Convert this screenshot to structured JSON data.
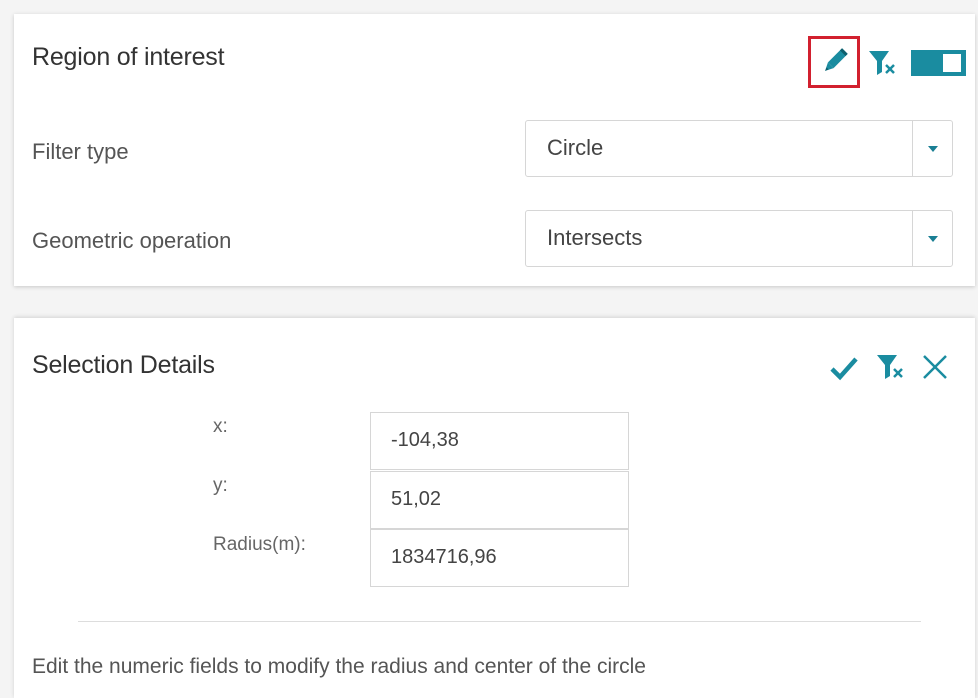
{
  "roi": {
    "title": "Region of interest",
    "filter_type": {
      "label": "Filter type",
      "value": "Circle"
    },
    "geometric_operation": {
      "label": "Geometric operation",
      "value": "Intersects"
    },
    "icons": [
      "edit-pencil-icon",
      "clear-filter-icon",
      "toggle-switch"
    ],
    "highlight_color": "#d2202f",
    "accent_color": "#1a8ca0"
  },
  "selection": {
    "title": "Selection Details",
    "icons": [
      "check-icon",
      "clear-filter-icon",
      "close-icon"
    ],
    "x": {
      "label": "x:",
      "value": "-104,38"
    },
    "y": {
      "label": "y:",
      "value": "51,02"
    },
    "radius": {
      "label": "Radius(m):",
      "value": "1834716,96"
    },
    "hint": "Edit the numeric fields to modify the radius and center of the circle"
  }
}
